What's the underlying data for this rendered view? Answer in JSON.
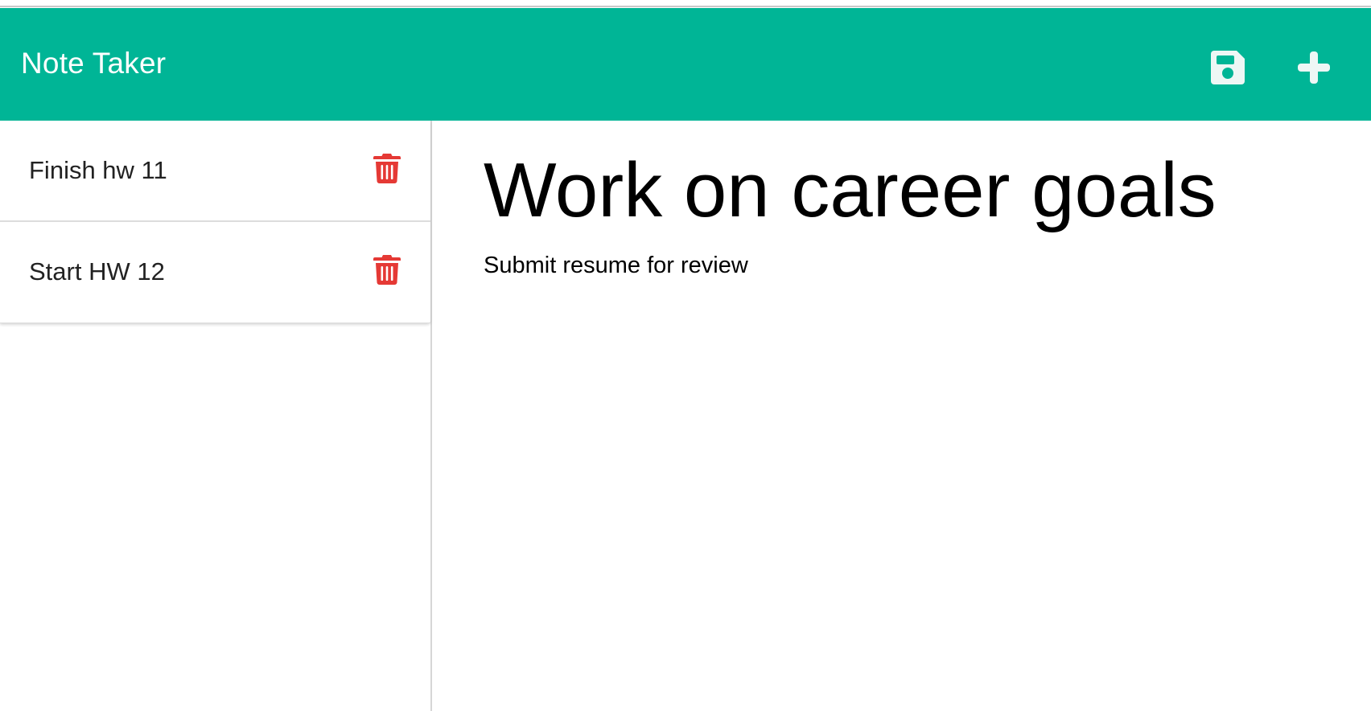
{
  "app": {
    "title": "Note Taker"
  },
  "toolbar": {
    "save_icon": "floppy-disk-save-icon",
    "add_icon": "plus-icon"
  },
  "sidebar": {
    "notes": [
      {
        "title": "Finish hw 11",
        "delete_icon": "trash-icon"
      },
      {
        "title": "Start HW 12",
        "delete_icon": "trash-icon"
      }
    ]
  },
  "editor": {
    "title": "Work on career goals",
    "body": "Submit resume for review"
  },
  "colors": {
    "brand": "#00b596",
    "danger": "#e53935",
    "icon_light": "#eef7f5"
  }
}
